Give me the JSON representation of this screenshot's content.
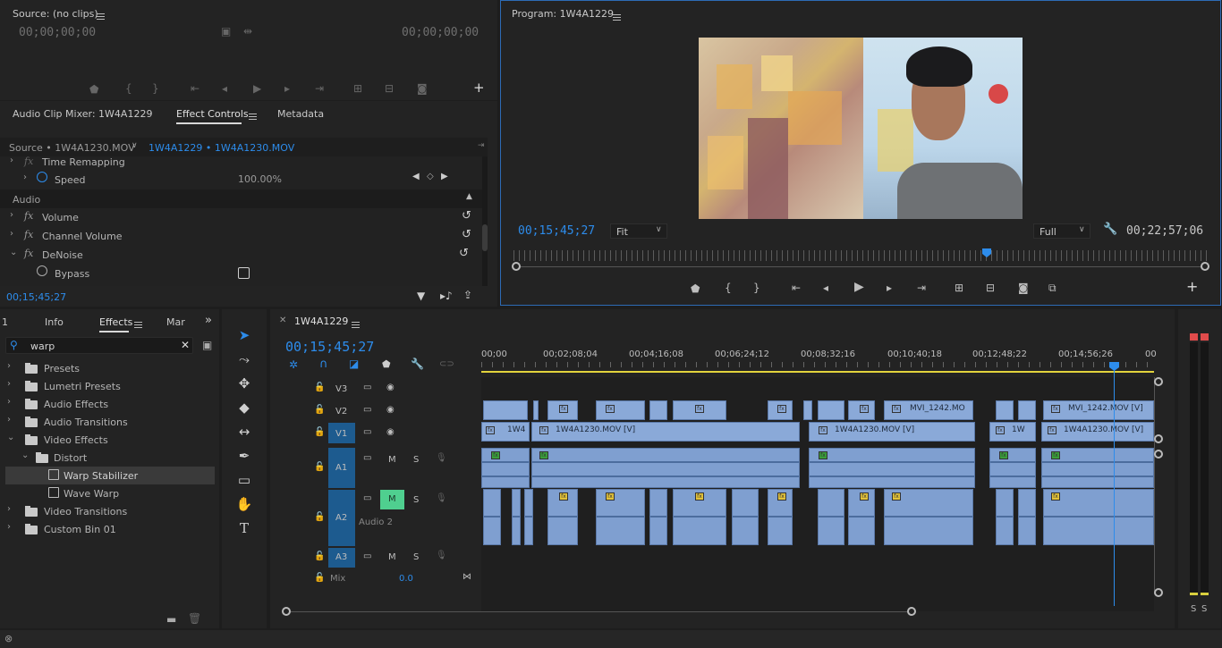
{
  "source_monitor": {
    "title": "Source: (no clips)",
    "timecode_left": "00;00;00;00",
    "timecode_right": "00;00;00;00"
  },
  "effect_controls": {
    "tabs": [
      "Audio Clip Mixer: 1W4A1229",
      "Effect Controls",
      "Metadata"
    ],
    "source_label": "Source • 1W4A1230.MOV",
    "clip_label": "1W4A1229 • 1W4A1230.MOV",
    "time_remapping": "Time Remapping",
    "speed_label": "Speed",
    "speed_value": "100.00%",
    "audio_section": "Audio",
    "volume": "Volume",
    "channel_volume": "Channel Volume",
    "denoise": "DeNoise",
    "bypass": "Bypass",
    "timecode": "00;15;45;27"
  },
  "program_monitor": {
    "title": "Program: 1W4A1229",
    "timecode": "00;15;45;27",
    "fit": "Fit",
    "quality": "Full",
    "duration": "00;22;57;06"
  },
  "effects_panel": {
    "tabs": [
      "1",
      "Info",
      "Effects",
      "Mar"
    ],
    "search_value": "warp",
    "items": [
      {
        "label": "Presets",
        "depth": 0,
        "expanded": false
      },
      {
        "label": "Lumetri Presets",
        "depth": 0,
        "expanded": false
      },
      {
        "label": "Audio Effects",
        "depth": 0,
        "expanded": false
      },
      {
        "label": "Audio Transitions",
        "depth": 0,
        "expanded": false
      },
      {
        "label": "Video Effects",
        "depth": 0,
        "expanded": true
      },
      {
        "label": "Distort",
        "depth": 1,
        "expanded": true
      },
      {
        "label": "Warp Stabilizer",
        "depth": 2,
        "selected": true
      },
      {
        "label": "Wave Warp",
        "depth": 2
      },
      {
        "label": "Video Transitions",
        "depth": 0,
        "expanded": false
      },
      {
        "label": "Custom Bin 01",
        "depth": 0,
        "expanded": false
      }
    ]
  },
  "timeline": {
    "sequence": "1W4A1229",
    "timecode": "00;15;45;27",
    "ruler": [
      "00;00",
      "00;02;08;04",
      "00;04;16;08",
      "00;06;24;12",
      "00;08;32;16",
      "00;10;40;18",
      "00;12;48;22",
      "00;14;56;26",
      "00"
    ],
    "tracks": {
      "v3": "V3",
      "v2": "V2",
      "v1": "V1",
      "a1": "A1",
      "a2": "A2",
      "a3": "A3",
      "audio2": "Audio 2",
      "mix": "Mix",
      "mix_value": "0.0",
      "m": "M",
      "s": "S"
    },
    "clips": {
      "v2_a": "MVI_1242.MO",
      "v2_b": "MVI_1242.MOV [V]",
      "v1_a": "1W4",
      "v1_b": "1W4A1230.MOV [V]",
      "v1_c": "1W4A1230.MOV [V]",
      "v1_d": "1W",
      "v1_e": "1W4A1230.MOV [V]"
    }
  },
  "meter": {
    "s_left": "S",
    "s_right": "S"
  }
}
